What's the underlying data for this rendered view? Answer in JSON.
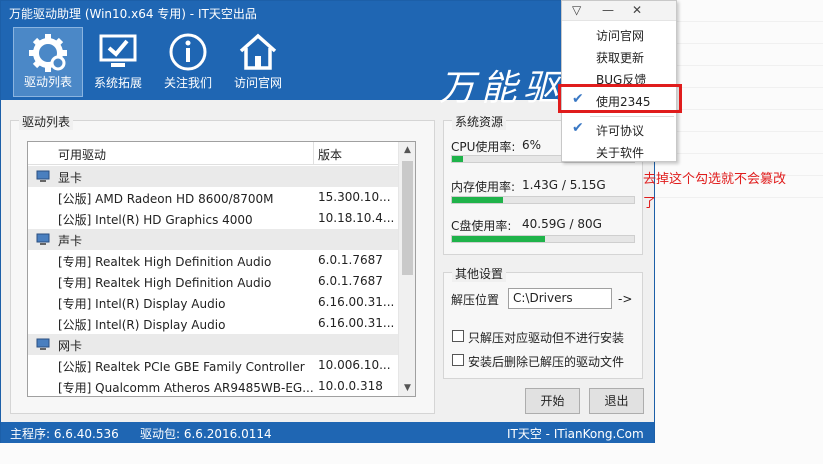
{
  "window": {
    "title": "万能驱动助理 (Win10.x64 专用) - IT天空出品",
    "controls": [
      "▽",
      "—",
      "✕"
    ]
  },
  "toolbar": {
    "items": [
      {
        "label": "驱动列表",
        "icon": "gear-icon",
        "active": true
      },
      {
        "label": "系统拓展",
        "icon": "monitor-check-icon",
        "active": false
      },
      {
        "label": "关注我们",
        "icon": "info-icon",
        "active": false
      },
      {
        "label": "访问官网",
        "icon": "home-icon",
        "active": false
      }
    ],
    "calligraphy": "万能驱"
  },
  "drivers": {
    "group_title": "驱动列表",
    "columns": [
      "可用驱动",
      "版本"
    ],
    "rows": [
      {
        "type": "category",
        "name": "显卡",
        "icon": "display-adapter-icon"
      },
      {
        "type": "item",
        "name": "[公版] AMD Radeon HD 8600/8700M",
        "version": "15.300.10..."
      },
      {
        "type": "item",
        "name": "[公版] Intel(R) HD Graphics 4000",
        "version": "10.18.10.4..."
      },
      {
        "type": "category",
        "name": "声卡",
        "icon": "speaker-icon"
      },
      {
        "type": "item",
        "name": "[专用] Realtek High Definition Audio",
        "version": "6.0.1.7687"
      },
      {
        "type": "item",
        "name": "[专用] Realtek High Definition Audio",
        "version": "6.0.1.7687"
      },
      {
        "type": "item",
        "name": "[专用] Intel(R) Display Audio",
        "version": "6.16.00.31..."
      },
      {
        "type": "item",
        "name": "[公版] Intel(R) Display Audio",
        "version": "6.16.00.31..."
      },
      {
        "type": "category",
        "name": "网卡",
        "icon": "network-icon"
      },
      {
        "type": "item",
        "name": "[公版] Realtek PCIe GBE Family Controller",
        "version": "10.006.10..."
      },
      {
        "type": "item",
        "name": "[专用] Qualcomm Atheros AR9485WB-EG...",
        "version": "10.0.0.318"
      }
    ]
  },
  "resources": {
    "group_title": "系统资源",
    "cpu": {
      "label": "CPU使用率:",
      "value": "6%",
      "fraction": 0.06
    },
    "memory": {
      "label": "内存使用率:",
      "value": "1.43G / 5.15G",
      "fraction": 0.28
    },
    "disk": {
      "label": "C盘使用率:",
      "value": "40.59G / 80G",
      "fraction": 0.51
    }
  },
  "settings": {
    "group_title": "其他设置",
    "extract_label": "解压位置",
    "extract_path": "C:\\Drivers",
    "arrow": "->",
    "opt1": "只解压对应驱动但不进行安装",
    "opt2": "安装后删除已解压的驱动文件"
  },
  "buttons": {
    "start": "开始",
    "exit": "退出"
  },
  "status": {
    "main": "主程序: 6.6.40.536",
    "pack": "驱动包: 6.6.2016.0114",
    "site": "IT天空 - ITianKong.Com"
  },
  "menu": {
    "items": [
      {
        "label": "访问官网",
        "checked": false
      },
      {
        "label": "获取更新",
        "checked": false
      },
      {
        "label": "BUG反馈",
        "checked": false
      },
      {
        "label": "使用2345",
        "checked": true
      },
      {
        "label": "许可协议",
        "checked": true
      },
      {
        "label": "关于软件",
        "checked": false
      }
    ]
  },
  "annotation": {
    "note": "去掉这个勾选就不会篡改了",
    "color": "#e01c1c"
  },
  "colors": {
    "accent": "#1f66b3",
    "progress": "#1fb34a"
  }
}
